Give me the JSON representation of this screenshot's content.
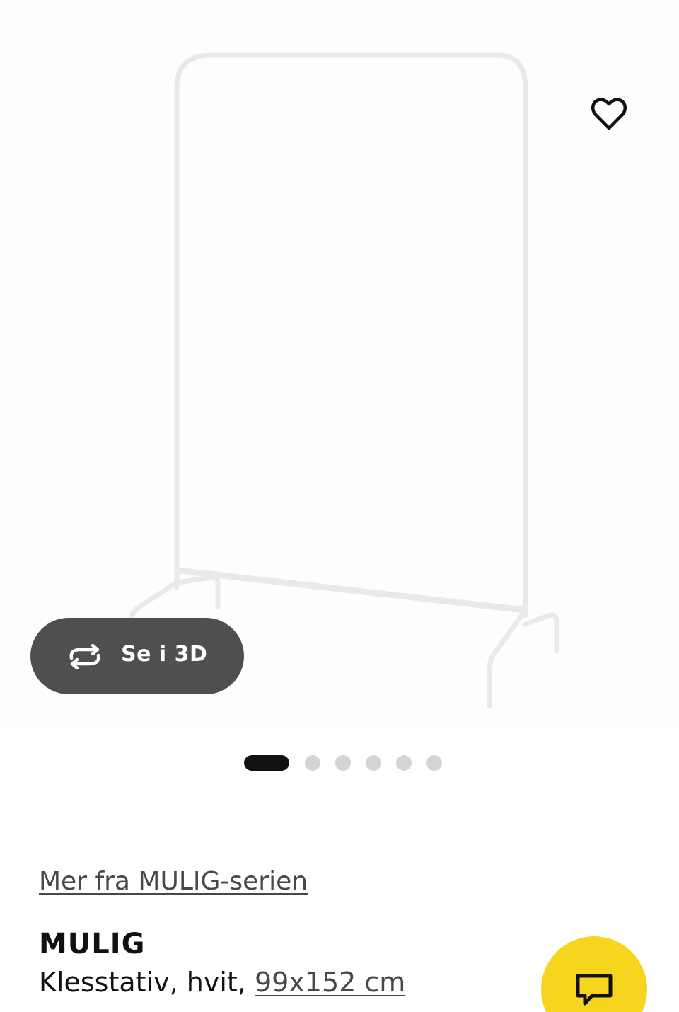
{
  "gallery": {
    "view3d_label": "Se i 3D",
    "active_index": 0,
    "dot_count": 6
  },
  "product": {
    "series_link": "Mer fra MULIG-serien",
    "name": "MULIG",
    "description_prefix": "Klesstativ, hvit, ",
    "size_link": "99x152 cm"
  },
  "icons": {
    "favorite": "heart-icon",
    "view3d": "rotate-3d-icon",
    "chat": "chat-bubble-icon"
  },
  "colors": {
    "chat_button": "#f6d51f",
    "view3d_button": "#4f4f4f",
    "active_dot": "#111111",
    "inactive_dot": "#d4d4d4"
  }
}
